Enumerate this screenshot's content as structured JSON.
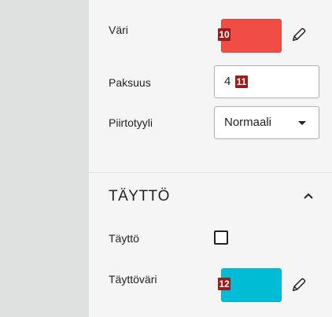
{
  "stroke": {
    "color_label": "Väri",
    "color_value": "#f04e45",
    "color_badge": "10",
    "thickness_label": "Paksuus",
    "thickness_value": "4",
    "thickness_badge": "11",
    "style_label": "Piirtotyyli",
    "style_value": "Normaali"
  },
  "fill": {
    "section_title": "TÄYTTÖ",
    "fill_label": "Täyttö",
    "fill_checked": false,
    "fill_color_label": "Täyttöväri",
    "fill_color_value": "#00bcd4",
    "fill_color_badge": "12"
  },
  "icons": {
    "pencil": "pencil-icon",
    "dropdown": "caret-down-icon",
    "collapse": "chevron-up-icon"
  }
}
